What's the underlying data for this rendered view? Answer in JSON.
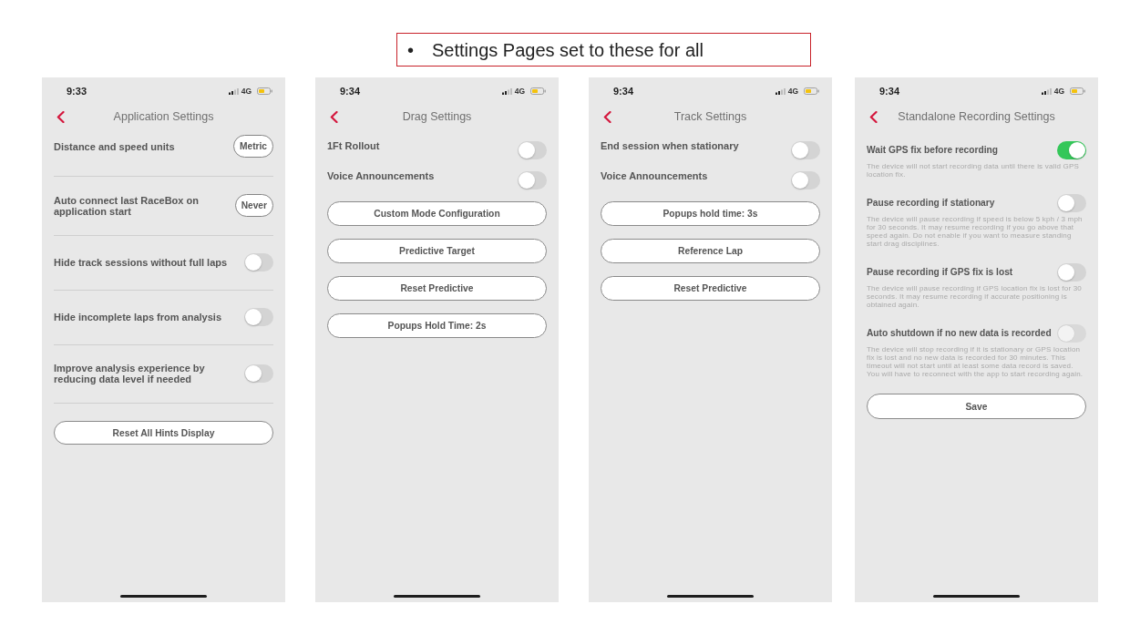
{
  "banner": {
    "bullet": "•",
    "text": "Settings Pages set to these for all"
  },
  "screens": [
    {
      "kind": "divided",
      "status_bar": {
        "time": "9:33",
        "network": "4G"
      },
      "title": "Application Settings",
      "items": [
        {
          "kind": "option",
          "label": "Distance and speed units",
          "value": "Metric"
        },
        {
          "kind": "option",
          "label": "Auto connect last RaceBox on application start",
          "value": "Never"
        },
        {
          "kind": "toggle",
          "label": "Hide track sessions without full laps",
          "on": false
        },
        {
          "kind": "toggle",
          "label": "Hide incomplete laps from analysis",
          "on": false
        },
        {
          "kind": "toggle",
          "label": "Improve analysis experience by reducing data level if needed",
          "on": false
        },
        {
          "kind": "button",
          "label": "Reset All Hints Display"
        }
      ]
    },
    {
      "kind": "compact",
      "status_bar": {
        "time": "9:34",
        "network": "4G"
      },
      "title": "Drag Settings",
      "items": [
        {
          "kind": "toggle",
          "label": "1Ft Rollout",
          "on": false
        },
        {
          "kind": "toggle",
          "label": "Voice Announcements",
          "on": false
        },
        {
          "kind": "button",
          "label": "Custom Mode Configuration"
        },
        {
          "kind": "button",
          "label": "Predictive Target"
        },
        {
          "kind": "button",
          "label": "Reset Predictive"
        },
        {
          "kind": "button",
          "label": "Popups Hold Time: 2s"
        }
      ]
    },
    {
      "kind": "compact",
      "status_bar": {
        "time": "9:34",
        "network": "4G"
      },
      "title": "Track Settings",
      "items": [
        {
          "kind": "toggle",
          "label": "End session when stationary",
          "on": false
        },
        {
          "kind": "toggle",
          "label": "Voice Announcements",
          "on": false
        },
        {
          "kind": "button",
          "label": "Popups hold time: 3s"
        },
        {
          "kind": "button",
          "label": "Reference Lap"
        },
        {
          "kind": "button",
          "label": "Reset Predictive"
        }
      ]
    },
    {
      "kind": "described",
      "status_bar": {
        "time": "9:34",
        "network": "4G"
      },
      "title": "Standalone Recording Settings",
      "items": [
        {
          "kind": "toggle",
          "label": "Wait GPS fix before recording",
          "description": "The device will not start recording data until there is valid GPS location fix.",
          "on": true,
          "disabled": false
        },
        {
          "kind": "toggle",
          "label": "Pause recording if stationary",
          "description": "The device will pause recording if speed is below 5 kph / 3 mph for 30 seconds. It may resume recording if you go above that speed again. Do not enable if you want to measure standing start drag disciplines.",
          "on": false,
          "disabled": false
        },
        {
          "kind": "toggle",
          "label": "Pause recording if GPS fix is lost",
          "description": "The device will pause recording if GPS location fix is lost for 30 seconds. It may resume recording if accurate positioning is obtained again.",
          "on": false,
          "disabled": false
        },
        {
          "kind": "toggle",
          "label": "Auto shutdown if no new data is recorded",
          "description": "The device will stop recording if it is stationary or GPS location fix is lost and no new data is recorded for 30 minutes. This timeout will not start until at least some data record is saved. You will have to reconnect with the app to start recording again.",
          "on": false,
          "disabled": true
        },
        {
          "kind": "button",
          "label": "Save"
        }
      ]
    }
  ]
}
